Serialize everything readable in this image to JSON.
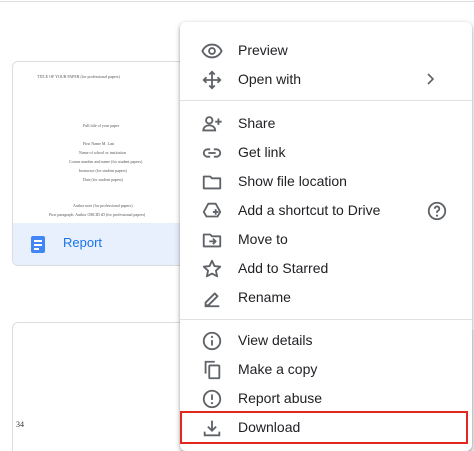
{
  "file_card": {
    "name": "Report",
    "thumbnail_lines": [
      "TITLE OF YOUR PAPER (for professional papers)",
      "Full title of your paper",
      "First Name M. Last",
      "Name of school or institution",
      "Course number and name (for student papers)",
      "Instructor (for student papers)",
      "Date (for student papers)",
      "Author note (for professional papers)",
      "First paragraph, Author ORCID iD (for professional papers)"
    ]
  },
  "second_card": {
    "page_number": "34"
  },
  "menu": {
    "items": [
      {
        "label": "Preview",
        "icon": "eye-icon"
      },
      {
        "label": "Open with",
        "icon": "move-arrows-icon",
        "submenu_icon": "chevron-right-icon"
      },
      {
        "label": "Share",
        "icon": "person-add-icon"
      },
      {
        "label": "Get link",
        "icon": "link-icon"
      },
      {
        "label": "Show file location",
        "icon": "folder-icon"
      },
      {
        "label": "Add a shortcut to Drive",
        "icon": "drive-shortcut-icon",
        "help_icon": "help-circle-icon"
      },
      {
        "label": "Move to",
        "icon": "move-to-folder-icon"
      },
      {
        "label": "Add to Starred",
        "icon": "star-icon"
      },
      {
        "label": "Rename",
        "icon": "pencil-icon"
      },
      {
        "label": "View details",
        "icon": "info-icon"
      },
      {
        "label": "Make a copy",
        "icon": "copy-icon"
      },
      {
        "label": "Report abuse",
        "icon": "alert-icon"
      },
      {
        "label": "Download",
        "icon": "download-icon",
        "highlighted": true
      }
    ]
  },
  "colors": {
    "accent": "#1a73e8",
    "selected_card_bg": "#e8f0fe",
    "highlight_border": "#e0281f",
    "icon": "#5f6368"
  }
}
